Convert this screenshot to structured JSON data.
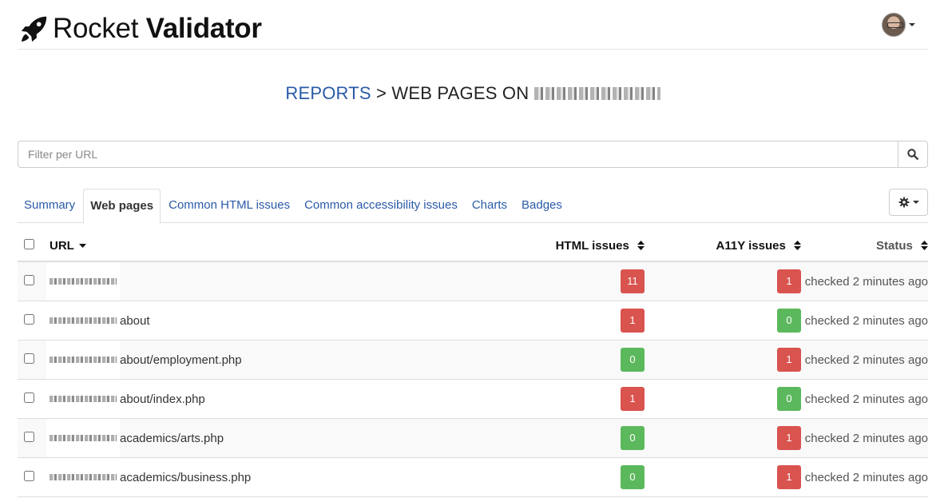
{
  "brand": {
    "name_light": "Rocket",
    "name_bold": "Validator"
  },
  "title": {
    "link": "REPORTS",
    "separator": ">",
    "text": "WEB PAGES ON"
  },
  "search": {
    "placeholder": "Filter per URL"
  },
  "tabs": [
    {
      "label": "Summary",
      "active": false
    },
    {
      "label": "Web pages",
      "active": true
    },
    {
      "label": "Common HTML issues",
      "active": false
    },
    {
      "label": "Common accessibility issues",
      "active": false
    },
    {
      "label": "Charts",
      "active": false
    },
    {
      "label": "Badges",
      "active": false
    }
  ],
  "table": {
    "headers": {
      "url": "URL",
      "html": "HTML issues",
      "a11y": "A11Y issues",
      "status": "Status"
    },
    "rows": [
      {
        "url": "",
        "html": "11",
        "html_color": "red",
        "a11y": "1",
        "a11y_color": "red",
        "status": "checked 2 minutes ago"
      },
      {
        "url": "about",
        "html": "1",
        "html_color": "red",
        "a11y": "0",
        "a11y_color": "green",
        "status": "checked 2 minutes ago"
      },
      {
        "url": "about/employment.php",
        "html": "0",
        "html_color": "green",
        "a11y": "1",
        "a11y_color": "red",
        "status": "checked 2 minutes ago"
      },
      {
        "url": "about/index.php",
        "html": "1",
        "html_color": "red",
        "a11y": "0",
        "a11y_color": "green",
        "status": "checked 2 minutes ago"
      },
      {
        "url": "academics/arts.php",
        "html": "0",
        "html_color": "green",
        "a11y": "1",
        "a11y_color": "red",
        "status": "checked 2 minutes ago"
      },
      {
        "url": "academics/business.php",
        "html": "0",
        "html_color": "green",
        "a11y": "1",
        "a11y_color": "red",
        "status": "checked 2 minutes ago"
      }
    ]
  },
  "colors": {
    "link": "#2a5aa7",
    "danger": "#d9534f",
    "success": "#5cb85c"
  },
  "icons": {
    "brand": "rocket-icon",
    "search": "search-icon",
    "settings": "gear-icon",
    "sort": "sort-icon",
    "sort_down": "caret-down-icon"
  }
}
